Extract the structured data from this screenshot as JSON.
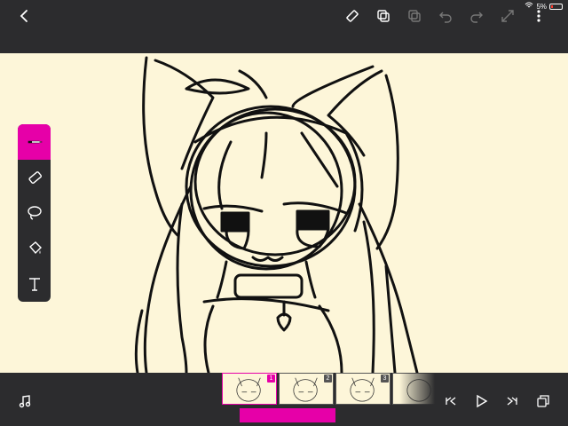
{
  "status": {
    "battery_percent": "5%"
  },
  "colors": {
    "accent": "#e600a8",
    "canvas": "#fdf6d9",
    "chrome": "#2c2c2e"
  },
  "toolbar": {
    "icons": [
      "back-icon",
      "ruler-icon",
      "copy-frame-icon",
      "paste-frame-icon",
      "undo-icon",
      "redo-icon",
      "fullscreen-icon",
      "more-icon"
    ]
  },
  "tools": [
    "brush-icon",
    "eraser-icon",
    "lasso-icon",
    "fill-bucket-icon",
    "text-icon"
  ],
  "frames": [
    {
      "number": "1",
      "active": true
    },
    {
      "number": "2",
      "active": false
    },
    {
      "number": "3",
      "active": false
    }
  ],
  "playback": [
    "first-frame-icon",
    "play-icon",
    "last-frame-icon",
    "layers-icon"
  ]
}
